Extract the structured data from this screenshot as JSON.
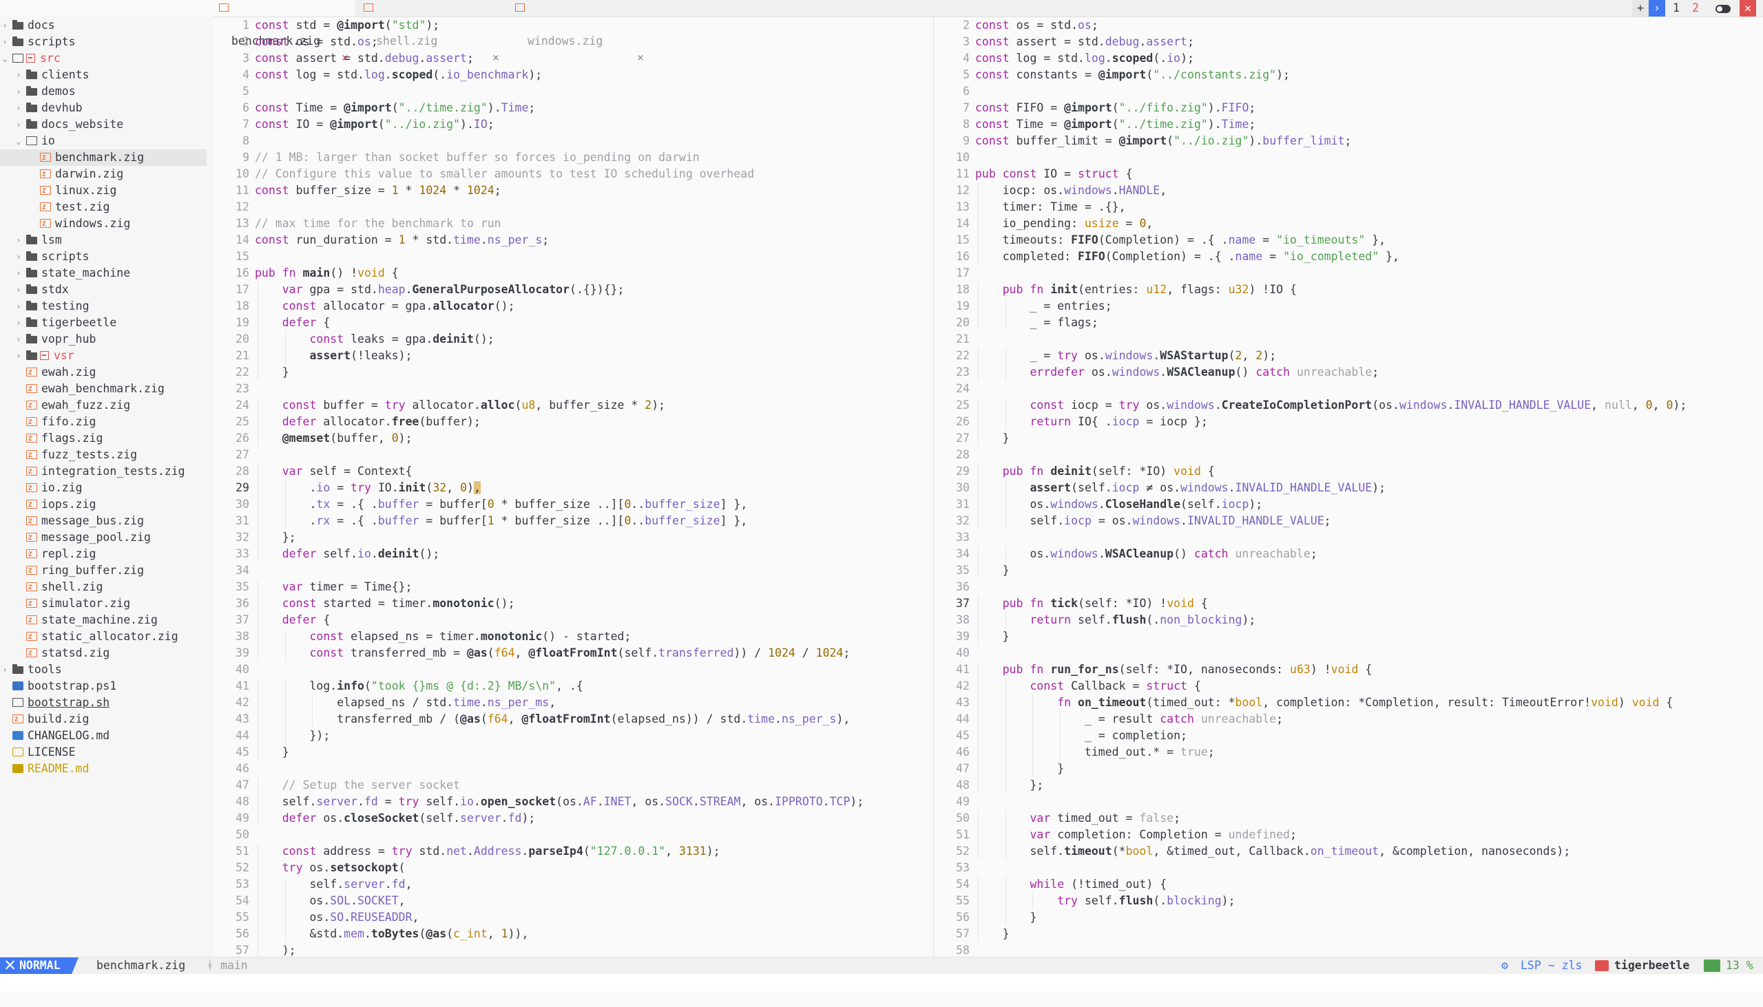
{
  "tabs": [
    {
      "label": "benchmark.zig",
      "active": true
    },
    {
      "label": "shell.zig",
      "active": false
    },
    {
      "label": "windows.zig",
      "active": false
    }
  ],
  "tab_controls": {
    "add": "+",
    "next": "›",
    "pane1": "1",
    "pane2": "2"
  },
  "tree": [
    {
      "label": "docs",
      "depth": 0,
      "type": "folder",
      "chev": ">",
      "icon": "folder"
    },
    {
      "label": "scripts",
      "depth": 0,
      "type": "folder",
      "chev": ">",
      "icon": "folder"
    },
    {
      "label": "src",
      "depth": 0,
      "type": "folder-open",
      "chev": "v",
      "icon": "folder-open",
      "error": true
    },
    {
      "label": "clients",
      "depth": 1,
      "type": "folder",
      "chev": ">",
      "icon": "folder"
    },
    {
      "label": "demos",
      "depth": 1,
      "type": "folder",
      "chev": ">",
      "icon": "folder"
    },
    {
      "label": "devhub",
      "depth": 1,
      "type": "folder",
      "chev": ">",
      "icon": "folder"
    },
    {
      "label": "docs_website",
      "depth": 1,
      "type": "folder",
      "chev": ">",
      "icon": "folder"
    },
    {
      "label": "io",
      "depth": 1,
      "type": "folder-open",
      "chev": "v",
      "icon": "folder-open"
    },
    {
      "label": "benchmark.zig",
      "depth": 2,
      "type": "file",
      "icon": "zig",
      "active": true
    },
    {
      "label": "darwin.zig",
      "depth": 2,
      "type": "file",
      "icon": "zig"
    },
    {
      "label": "linux.zig",
      "depth": 2,
      "type": "file",
      "icon": "zig"
    },
    {
      "label": "test.zig",
      "depth": 2,
      "type": "file",
      "icon": "zig"
    },
    {
      "label": "windows.zig",
      "depth": 2,
      "type": "file",
      "icon": "zig"
    },
    {
      "label": "lsm",
      "depth": 1,
      "type": "folder",
      "chev": ">",
      "icon": "folder"
    },
    {
      "label": "scripts",
      "depth": 1,
      "type": "folder",
      "chev": ">",
      "icon": "folder"
    },
    {
      "label": "state_machine",
      "depth": 1,
      "type": "folder",
      "chev": ">",
      "icon": "folder"
    },
    {
      "label": "stdx",
      "depth": 1,
      "type": "folder",
      "chev": ">",
      "icon": "folder"
    },
    {
      "label": "testing",
      "depth": 1,
      "type": "folder",
      "chev": ">",
      "icon": "folder"
    },
    {
      "label": "tigerbeetle",
      "depth": 1,
      "type": "folder",
      "chev": ">",
      "icon": "folder"
    },
    {
      "label": "vopr_hub",
      "depth": 1,
      "type": "folder",
      "chev": ">",
      "icon": "folder"
    },
    {
      "label": "vsr",
      "depth": 1,
      "type": "folder",
      "chev": ">",
      "icon": "folder",
      "error": true
    },
    {
      "label": "ewah.zig",
      "depth": 1,
      "type": "file",
      "icon": "zig"
    },
    {
      "label": "ewah_benchmark.zig",
      "depth": 1,
      "type": "file",
      "icon": "zig"
    },
    {
      "label": "ewah_fuzz.zig",
      "depth": 1,
      "type": "file",
      "icon": "zig"
    },
    {
      "label": "fifo.zig",
      "depth": 1,
      "type": "file",
      "icon": "zig"
    },
    {
      "label": "flags.zig",
      "depth": 1,
      "type": "file",
      "icon": "zig"
    },
    {
      "label": "fuzz_tests.zig",
      "depth": 1,
      "type": "file",
      "icon": "zig"
    },
    {
      "label": "integration_tests.zig",
      "depth": 1,
      "type": "file",
      "icon": "zig"
    },
    {
      "label": "io.zig",
      "depth": 1,
      "type": "file",
      "icon": "zig"
    },
    {
      "label": "iops.zig",
      "depth": 1,
      "type": "file",
      "icon": "zig"
    },
    {
      "label": "message_bus.zig",
      "depth": 1,
      "type": "file",
      "icon": "zig"
    },
    {
      "label": "message_pool.zig",
      "depth": 1,
      "type": "file",
      "icon": "zig"
    },
    {
      "label": "repl.zig",
      "depth": 1,
      "type": "file",
      "icon": "zig"
    },
    {
      "label": "ring_buffer.zig",
      "depth": 1,
      "type": "file",
      "icon": "zig"
    },
    {
      "label": "shell.zig",
      "depth": 1,
      "type": "file",
      "icon": "zig"
    },
    {
      "label": "simulator.zig",
      "depth": 1,
      "type": "file",
      "icon": "zig"
    },
    {
      "label": "state_machine.zig",
      "depth": 1,
      "type": "file",
      "icon": "zig"
    },
    {
      "label": "static_allocator.zig",
      "depth": 1,
      "type": "file",
      "icon": "zig"
    },
    {
      "label": "statsd.zig",
      "depth": 1,
      "type": "file",
      "icon": "zig"
    },
    {
      "label": "tools",
      "depth": 0,
      "type": "folder",
      "chev": ">",
      "icon": "folder"
    },
    {
      "label": "bootstrap.ps1",
      "depth": 0,
      "type": "file",
      "icon": "ps"
    },
    {
      "label": "bootstrap.sh",
      "depth": 0,
      "type": "file",
      "icon": "sh",
      "underline": true
    },
    {
      "label": "build.zig",
      "depth": 0,
      "type": "file",
      "icon": "zig"
    },
    {
      "label": "CHANGELOG.md",
      "depth": 0,
      "type": "file",
      "icon": "md"
    },
    {
      "label": "LICENSE",
      "depth": 0,
      "type": "file",
      "icon": "lic"
    },
    {
      "label": "README.md",
      "depth": 0,
      "type": "file",
      "icon": "readme",
      "warn": true
    }
  ],
  "editor_left": {
    "file": "benchmark.zig",
    "cursor_line": 29,
    "lines": [
      [
        1,
        "const std = @import(\"std\");"
      ],
      [
        2,
        "const os = std.os;"
      ],
      [
        3,
        "const assert = std.debug.assert;"
      ],
      [
        4,
        "const log = std.log.scoped(.io_benchmark);"
      ],
      [
        5,
        ""
      ],
      [
        6,
        "const Time = @import(\"../time.zig\").Time;"
      ],
      [
        7,
        "const IO = @import(\"../io.zig\").IO;"
      ],
      [
        8,
        ""
      ],
      [
        9,
        "// 1 MB: larger than socket buffer so forces io_pending on darwin"
      ],
      [
        10,
        "// Configure this value to smaller amounts to test IO scheduling overhead"
      ],
      [
        11,
        "const buffer_size = 1 * 1024 * 1024;"
      ],
      [
        12,
        ""
      ],
      [
        13,
        "// max time for the benchmark to run"
      ],
      [
        14,
        "const run_duration = 1 * std.time.ns_per_s;"
      ],
      [
        15,
        ""
      ],
      [
        16,
        "pub fn main() !void {"
      ],
      [
        17,
        "    var gpa = std.heap.GeneralPurposeAllocator(.{}){};"
      ],
      [
        18,
        "    const allocator = gpa.allocator();"
      ],
      [
        19,
        "    defer {"
      ],
      [
        20,
        "        const leaks = gpa.deinit();"
      ],
      [
        21,
        "        assert(!leaks);"
      ],
      [
        22,
        "    }"
      ],
      [
        23,
        ""
      ],
      [
        24,
        "    const buffer = try allocator.alloc(u8, buffer_size * 2);"
      ],
      [
        25,
        "    defer allocator.free(buffer);"
      ],
      [
        26,
        "    @memset(buffer, 0);"
      ],
      [
        27,
        ""
      ],
      [
        28,
        "    var self = Context{"
      ],
      [
        29,
        "        .io = try IO.init(32, 0),"
      ],
      [
        30,
        "        .tx = .{ .buffer = buffer[0 * buffer_size ..][0..buffer_size] },"
      ],
      [
        31,
        "        .rx = .{ .buffer = buffer[1 * buffer_size ..][0..buffer_size] },"
      ],
      [
        32,
        "    };"
      ],
      [
        33,
        "    defer self.io.deinit();"
      ],
      [
        34,
        ""
      ],
      [
        35,
        "    var timer = Time{};"
      ],
      [
        36,
        "    const started = timer.monotonic();"
      ],
      [
        37,
        "    defer {"
      ],
      [
        38,
        "        const elapsed_ns = timer.monotonic() - started;"
      ],
      [
        39,
        "        const transferred_mb = @as(f64, @floatFromInt(self.transferred)) / 1024 / 1024;"
      ],
      [
        40,
        ""
      ],
      [
        41,
        "        log.info(\"took {}ms @ {d:.2} MB/s\\n\", .{"
      ],
      [
        42,
        "            elapsed_ns / std.time.ns_per_ms,"
      ],
      [
        43,
        "            transferred_mb / (@as(f64, @floatFromInt(elapsed_ns)) / std.time.ns_per_s),"
      ],
      [
        44,
        "        });"
      ],
      [
        45,
        "    }"
      ],
      [
        46,
        ""
      ],
      [
        47,
        "    // Setup the server socket"
      ],
      [
        48,
        "    self.server.fd = try self.io.open_socket(os.AF.INET, os.SOCK.STREAM, os.IPPROTO.TCP);"
      ],
      [
        49,
        "    defer os.closeSocket(self.server.fd);"
      ],
      [
        50,
        ""
      ],
      [
        51,
        "    const address = try std.net.Address.parseIp4(\"127.0.0.1\", 3131);"
      ],
      [
        52,
        "    try os.setsockopt("
      ],
      [
        53,
        "        self.server.fd,"
      ],
      [
        54,
        "        os.SOL.SOCKET,"
      ],
      [
        55,
        "        os.SO.REUSEADDR,"
      ],
      [
        56,
        "        &std.mem.toBytes(@as(c_int, 1)),"
      ],
      [
        57,
        "    );"
      ]
    ]
  },
  "editor_right": {
    "file": "windows.zig",
    "cursor_line": 37,
    "lines": [
      [
        2,
        "const os = std.os;"
      ],
      [
        3,
        "const assert = std.debug.assert;"
      ],
      [
        4,
        "const log = std.log.scoped(.io);"
      ],
      [
        5,
        "const constants = @import(\"../constants.zig\");"
      ],
      [
        6,
        ""
      ],
      [
        7,
        "const FIFO = @import(\"../fifo.zig\").FIFO;"
      ],
      [
        8,
        "const Time = @import(\"../time.zig\").Time;"
      ],
      [
        9,
        "const buffer_limit = @import(\"../io.zig\").buffer_limit;"
      ],
      [
        10,
        ""
      ],
      [
        11,
        "pub const IO = struct {"
      ],
      [
        12,
        "    iocp: os.windows.HANDLE,"
      ],
      [
        13,
        "    timer: Time = .{},"
      ],
      [
        14,
        "    io_pending: usize = 0,"
      ],
      [
        15,
        "    timeouts: FIFO(Completion) = .{ .name = \"io_timeouts\" },"
      ],
      [
        16,
        "    completed: FIFO(Completion) = .{ .name = \"io_completed\" },"
      ],
      [
        17,
        ""
      ],
      [
        18,
        "    pub fn init(entries: u12, flags: u32) !IO {"
      ],
      [
        19,
        "        _ = entries;"
      ],
      [
        20,
        "        _ = flags;"
      ],
      [
        21,
        ""
      ],
      [
        22,
        "        _ = try os.windows.WSAStartup(2, 2);"
      ],
      [
        23,
        "        errdefer os.windows.WSACleanup() catch unreachable;"
      ],
      [
        24,
        ""
      ],
      [
        25,
        "        const iocp = try os.windows.CreateIoCompletionPort(os.windows.INVALID_HANDLE_VALUE, null, 0, 0);"
      ],
      [
        26,
        "        return IO{ .iocp = iocp };"
      ],
      [
        27,
        "    }"
      ],
      [
        28,
        ""
      ],
      [
        29,
        "    pub fn deinit(self: *IO) void {"
      ],
      [
        30,
        "        assert(self.iocp ≠ os.windows.INVALID_HANDLE_VALUE);"
      ],
      [
        31,
        "        os.windows.CloseHandle(self.iocp);"
      ],
      [
        32,
        "        self.iocp = os.windows.INVALID_HANDLE_VALUE;"
      ],
      [
        33,
        ""
      ],
      [
        34,
        "        os.windows.WSACleanup() catch unreachable;"
      ],
      [
        35,
        "    }"
      ],
      [
        36,
        ""
      ],
      [
        37,
        "    pub fn tick(self: *IO) !void {"
      ],
      [
        38,
        "        return self.flush(.non_blocking);"
      ],
      [
        39,
        "    }"
      ],
      [
        40,
        ""
      ],
      [
        41,
        "    pub fn run_for_ns(self: *IO, nanoseconds: u63) !void {"
      ],
      [
        42,
        "        const Callback = struct {"
      ],
      [
        43,
        "            fn on_timeout(timed_out: *bool, completion: *Completion, result: TimeoutError!void) void {"
      ],
      [
        44,
        "                _ = result catch unreachable;"
      ],
      [
        45,
        "                _ = completion;"
      ],
      [
        46,
        "                timed_out.* = true;"
      ],
      [
        47,
        "            }"
      ],
      [
        48,
        "        };"
      ],
      [
        49,
        ""
      ],
      [
        50,
        "        var timed_out = false;"
      ],
      [
        51,
        "        var completion: Completion = undefined;"
      ],
      [
        52,
        "        self.timeout(*bool, &timed_out, Callback.on_timeout, &completion, nanoseconds);"
      ],
      [
        53,
        ""
      ],
      [
        54,
        "        while (!timed_out) {"
      ],
      [
        55,
        "            try self.flush(.blocking);"
      ],
      [
        56,
        "        }"
      ],
      [
        57,
        "    }"
      ],
      [
        58,
        ""
      ]
    ]
  },
  "status": {
    "mode": "NORMAL",
    "file": "benchmark.zig",
    "branch": "main",
    "lsp": "LSP ~ zls",
    "project": "tigerbeetle",
    "percent": "13 %"
  },
  "colors": {
    "accent": "#4078f2",
    "error": "#e05252",
    "zig": "#e8743b",
    "warn": "#c8a000",
    "green": "#50a14f"
  }
}
